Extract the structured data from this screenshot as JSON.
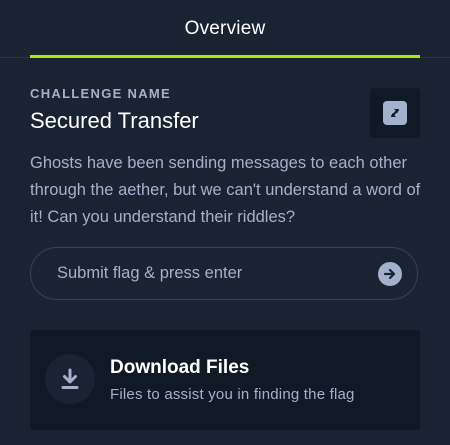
{
  "tabs": [
    {
      "label": "Overview",
      "active": true
    }
  ],
  "challenge": {
    "overline": "CHALLENGE NAME",
    "name": "Secured Transfer",
    "description": "Ghosts have been sending messages to each other through the aether, but we can't understand a word of it! Can you understand their riddles?",
    "action_icon": "switch-arrows-icon"
  },
  "flag": {
    "placeholder": "Submit flag & press enter",
    "value": "",
    "submit_icon": "arrow-right-icon"
  },
  "download": {
    "title": "Download Files",
    "subtitle": "Files to assist you in finding the flag",
    "icon": "download-icon"
  },
  "colors": {
    "background": "#1a2332",
    "card": "#111927",
    "accent": "#9fef00",
    "muted_text": "#a4b1cd"
  }
}
